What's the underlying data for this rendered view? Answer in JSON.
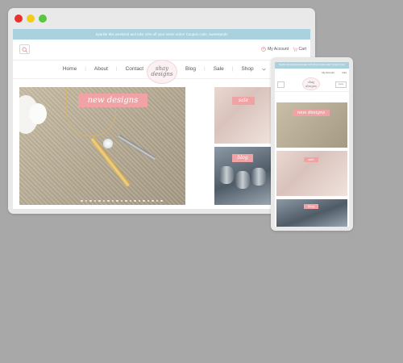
{
  "desktop": {
    "promo_text": "Sparkle this weekend and take 10% off your entire order! Coupon code, sweetsands",
    "account_label": "My Account",
    "cart_label": "Cart",
    "nav_left": [
      "Home",
      "About",
      "Contact"
    ],
    "nav_right": [
      "Blog",
      "Sale",
      "Shop"
    ],
    "logo_line1": "shay",
    "logo_line2": "designs",
    "hero_banner": "new designs",
    "tile_sale_label": "sale",
    "tile_blog_label": "blog"
  },
  "mobile": {
    "promo_text": "Sparkle this weekend and take 10% off your entire order! Coupon code, sweetsands",
    "account_label": "My Account",
    "cart_label": "Cart",
    "logo_line1": "shay",
    "logo_line2": "designs",
    "menu_label": "menu",
    "hero_banner": "new designs",
    "sale_label": "sale",
    "blog_label": "blog"
  },
  "colors": {
    "background": "#a8a8a8",
    "promo_bar": "#a9d2de",
    "ribbon": "#f1a2a4",
    "close_dot": "#e8322c",
    "minimize_dot": "#f3cc1b",
    "maximize_dot": "#57c73f"
  }
}
